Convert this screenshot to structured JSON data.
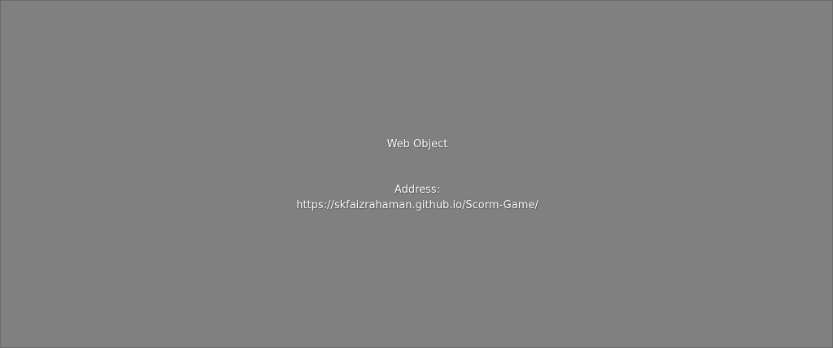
{
  "web_object": {
    "title": "Web Object",
    "address_label": "Address:",
    "address_value": "https://skfaizrahaman.github.io/Scorm-Game/"
  },
  "colors": {
    "background": "#808080",
    "text": "#ffffff"
  }
}
